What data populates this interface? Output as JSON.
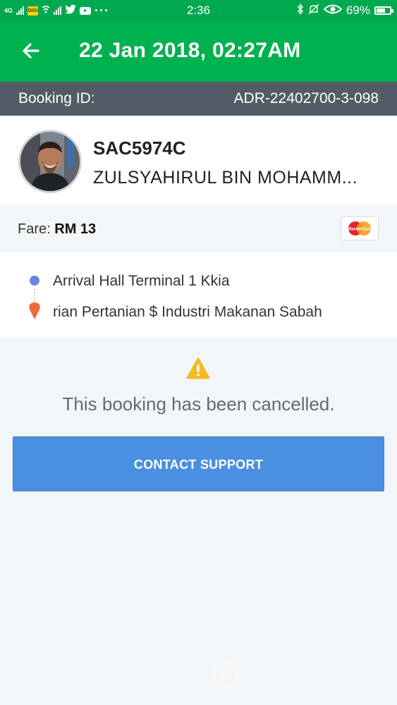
{
  "status_bar": {
    "network_label": "4G",
    "carrier_badge": "DiGi",
    "time": "2:36",
    "battery_percent": "69%",
    "battery_level": 0.69,
    "more_notifications": "···",
    "icons": [
      "signal-icon",
      "digi-icon",
      "wifi-icon",
      "twitter-icon",
      "youtube-icon",
      "bluetooth-icon",
      "mute-icon",
      "eye-icon",
      "battery-icon"
    ]
  },
  "header": {
    "back_icon": "arrow-left-icon",
    "title": "22 Jan 2018, 02:27AM"
  },
  "booking": {
    "label": "Booking ID:",
    "id": "ADR-22402700-3-098"
  },
  "driver": {
    "avatar_icon": "driver-photo",
    "plate": "SAC5974C",
    "name": "ZULSYAHIRUL BIN MOHAMM..."
  },
  "fare": {
    "label": "Fare:",
    "value": "RM 13",
    "payment_icon": "mastercard-icon",
    "payment_brand_text": "MasterCard"
  },
  "route": {
    "pickup": "Arrival Hall Terminal 1 Kkia",
    "dropoff": "rian Pertanian $ Industri Makanan Sabah",
    "pickup_icon": "pickup-dot-icon",
    "dropoff_icon": "location-pin-icon"
  },
  "status": {
    "warning_icon": "warning-icon",
    "message": "This booking has been cancelled."
  },
  "actions": {
    "contact_support": "CONTACT SUPPORT"
  },
  "colors": {
    "brand_green": "#00b14f",
    "booking_bar": "#525c66",
    "button_blue": "#4a8fe0",
    "warning_yellow": "#f5b925",
    "pin_orange": "#ee6a3b",
    "pickup_blue": "#6a86e0"
  }
}
